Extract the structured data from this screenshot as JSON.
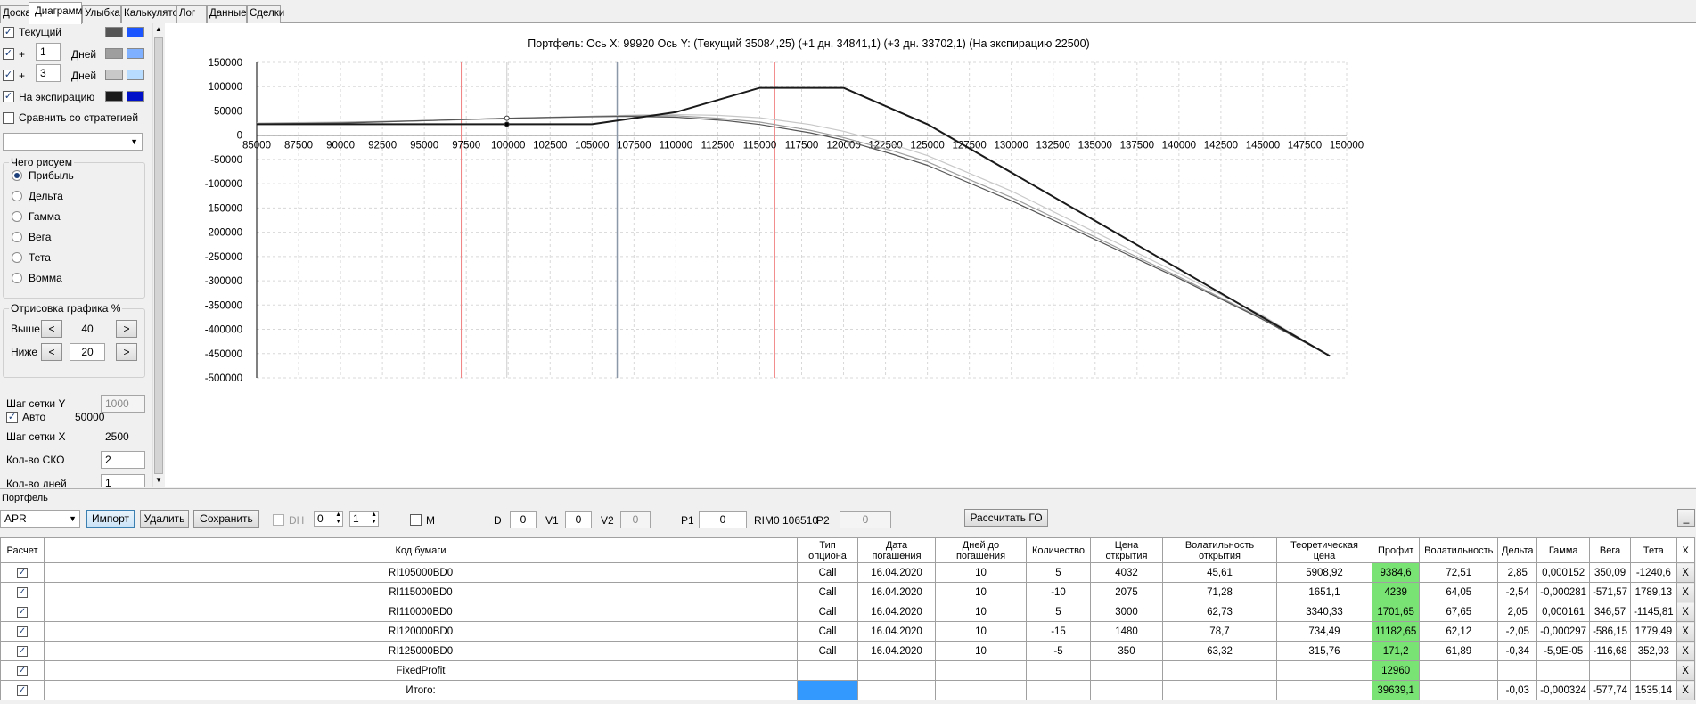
{
  "tabs": [
    "Доска",
    "Диаграмма",
    "Улыбка",
    "Калькулятор",
    "Лог",
    "Данные",
    "Сделки"
  ],
  "left_panel": {
    "current": {
      "label": "Текущий",
      "checked": true,
      "swatch1": "#555555",
      "swatch2": "#1a55ff"
    },
    "plus1": {
      "plus": "+",
      "value": "1",
      "unit": "Дней",
      "checked": true,
      "swatch1": "#9e9e9e",
      "swatch2": "#7fb0ff"
    },
    "plus3": {
      "plus": "+",
      "value": "3",
      "unit": "Дней",
      "checked": true,
      "swatch1": "#c8c8c8",
      "swatch2": "#b8dcff"
    },
    "expiry": {
      "label": "На экспирацию",
      "checked": true,
      "swatch1": "#1a1a1a",
      "swatch2": "#0010c8"
    },
    "compare": {
      "label": "Сравнить со стратегией",
      "checked": false
    },
    "draw_group": {
      "title": "Чего рисуем",
      "options": [
        "Прибыль",
        "Дельта",
        "Гамма",
        "Вега",
        "Тета",
        "Вомма"
      ],
      "selected": 0
    },
    "plot_group": {
      "title": "Отрисовка графика %",
      "above_label": "Выше",
      "above_value": "40",
      "below_label": "Ниже",
      "below_value": "20",
      "dec": "<",
      "inc": ">"
    },
    "grid_y": {
      "label": "Шаг сетки Y",
      "value": "1000"
    },
    "auto": {
      "label": "Авто",
      "checked": true,
      "value": "50000"
    },
    "grid_x": {
      "label": "Шаг сетки X",
      "value": "2500"
    },
    "sko": {
      "label": "Кол-во СКО",
      "value": "2"
    },
    "days": {
      "label": "Кол-во дней",
      "value": "1"
    }
  },
  "chart_data": {
    "type": "line",
    "title": "Портфель: Ось X: 99920 Ось Y: (Текущий 35084,25) (+1 дн. 34841,1) (+3 дн. 33702,1) (На экспирацию 22500)",
    "xlim": [
      85000,
      150000
    ],
    "ylim": [
      -500000,
      150000
    ],
    "x_ticks": [
      85000,
      87500,
      90000,
      92500,
      95000,
      97500,
      100000,
      102500,
      105000,
      107500,
      110000,
      112500,
      115000,
      117500,
      120000,
      122500,
      125000,
      127500,
      130000,
      132500,
      135000,
      137500,
      140000,
      142500,
      145000,
      147500,
      150000
    ],
    "y_ticks": [
      150000,
      100000,
      50000,
      0,
      -50000,
      -100000,
      -150000,
      -200000,
      -250000,
      -300000,
      -350000,
      -400000,
      -450000,
      -500000
    ],
    "grid": true,
    "vlines": {
      "red": [
        97200,
        115900
      ],
      "gray": 106500,
      "cursor": 99920
    },
    "series": [
      {
        "color": "#1a1a1a",
        "x": [
          85000,
          100000,
          105000,
          110000,
          115000,
          120000,
          125000,
          149000
        ],
        "y": [
          22500,
          22500,
          22500,
          47500,
          97500,
          97500,
          22500,
          -455000
        ]
      },
      {
        "color": "#555555",
        "x": [
          85000,
          90000,
          95000,
          100000,
          105000,
          107000,
          110000,
          113000,
          115000,
          118000,
          120000,
          123000,
          125000,
          130000,
          135000,
          140000,
          145000,
          149000
        ],
        "y": [
          23000,
          25000,
          30000,
          35084,
          38000,
          39000,
          37000,
          30000,
          22000,
          5000,
          -10000,
          -40000,
          -62000,
          -135000,
          -215000,
          -295000,
          -380000,
          -455000
        ]
      },
      {
        "color": "#9e9e9e",
        "x": [
          85000,
          90000,
          95000,
          100000,
          105000,
          107500,
          110000,
          112500,
          115000,
          118000,
          120000,
          123000,
          125000,
          130000,
          135000,
          140000,
          145000,
          149000
        ],
        "y": [
          24000,
          26000,
          30000,
          34841,
          39000,
          40500,
          40000,
          35000,
          27000,
          10000,
          -5000,
          -33000,
          -55000,
          -128000,
          -210000,
          -292000,
          -378000,
          -455000
        ]
      },
      {
        "color": "#c8c8c8",
        "x": [
          85000,
          90000,
          95000,
          100000,
          105000,
          108000,
          110000,
          112500,
          115000,
          118000,
          120000,
          123000,
          125000,
          130000,
          135000,
          140000,
          145000,
          149000
        ],
        "y": [
          25000,
          27000,
          30000,
          33702,
          39000,
          42000,
          42500,
          41000,
          36000,
          22000,
          8000,
          -20000,
          -42000,
          -115000,
          -200000,
          -285000,
          -372000,
          -455000
        ]
      }
    ],
    "cursor_points": [
      {
        "x": 99920,
        "y": 35084
      },
      {
        "x": 99920,
        "y": 22500
      }
    ]
  },
  "bottom": {
    "section_label": "Портфель",
    "series_select": "APR",
    "import_btn": "Импорт",
    "delete_btn": "Удалить",
    "save_btn": "Сохранить",
    "dh_label": "DH",
    "dh_v1": "0",
    "dh_v2": "1",
    "m_label": "M",
    "d_label": "D",
    "d_value": "0",
    "v1_label": "V1",
    "v1_value": "0",
    "v2_label": "V2",
    "v2_value": "0",
    "p1_label": "P1",
    "p1_value": "0",
    "rim_label": "RIM0 106510",
    "p2_label": "P2",
    "p2_value": "0",
    "go_btn": "Рассчитать ГО",
    "min_btn": "_"
  },
  "table": {
    "headers": [
      "Расчет",
      "Код бумаги",
      "Тип опциона",
      "Дата погашения",
      "Дней до погашения",
      "Количество",
      "Цена открытия",
      "Волатильность открытия",
      "Теоретическая цена",
      "Профит",
      "Волатильность",
      "Дельта",
      "Гамма",
      "Вега",
      "Тета",
      "X"
    ],
    "rows": [
      [
        "RI105000BD0",
        "Call",
        "16.04.2020",
        "10",
        "5",
        "4032",
        "45,61",
        "5908,92",
        "9384,6",
        "72,51",
        "2,85",
        "0,000152",
        "350,09",
        "-1240,6"
      ],
      [
        "RI115000BD0",
        "Call",
        "16.04.2020",
        "10",
        "-10",
        "2075",
        "71,28",
        "1651,1",
        "4239",
        "64,05",
        "-2,54",
        "-0,000281",
        "-571,57",
        "1789,13"
      ],
      [
        "RI110000BD0",
        "Call",
        "16.04.2020",
        "10",
        "5",
        "3000",
        "62,73",
        "3340,33",
        "1701,65",
        "67,65",
        "2,05",
        "0,000161",
        "346,57",
        "-1145,81"
      ],
      [
        "RI120000BD0",
        "Call",
        "16.04.2020",
        "10",
        "-15",
        "1480",
        "78,7",
        "734,49",
        "11182,65",
        "62,12",
        "-2,05",
        "-0,000297",
        "-586,15",
        "1779,49"
      ],
      [
        "RI125000BD0",
        "Call",
        "16.04.2020",
        "10",
        "-5",
        "350",
        "63,32",
        "315,76",
        "171,2",
        "61,89",
        "-0,34",
        "-5,9E-05",
        "-116,68",
        "352,93"
      ]
    ],
    "fixed": {
      "code": "FixedProfit",
      "profit": "12960"
    },
    "total": {
      "code": "Итого:",
      "profit": "39639,1",
      "delta": "-0,03",
      "gamma": "-0,000324",
      "vega": "-577,74",
      "theta": "1535,14"
    },
    "close": "X"
  }
}
